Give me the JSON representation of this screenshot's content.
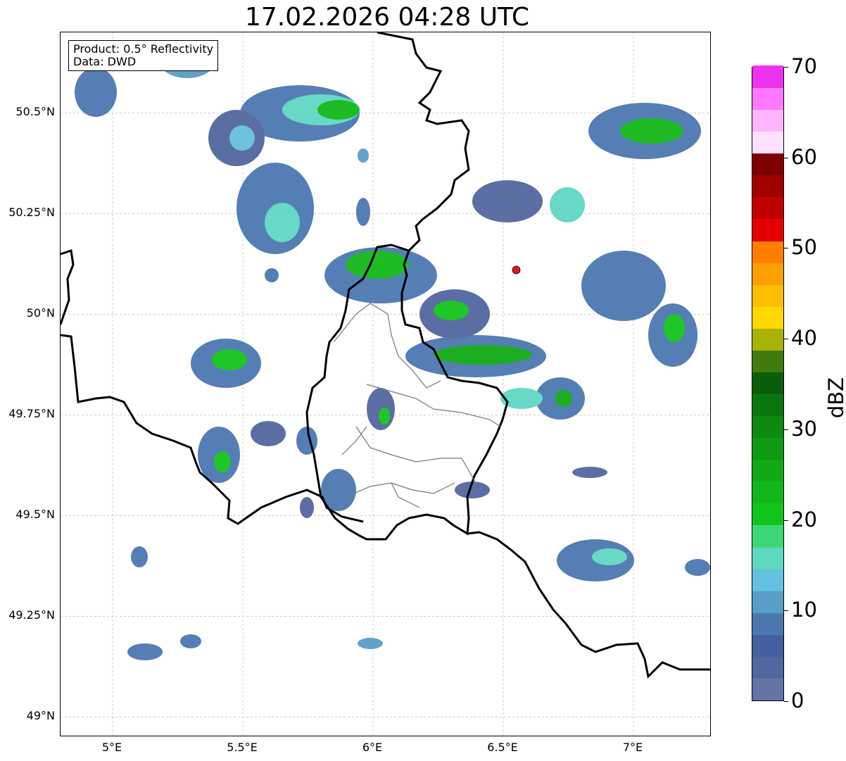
{
  "title": "17.02.2026 04:28 UTC",
  "info": {
    "product": "Product: 0.5° Reflectivity",
    "data": "Data: DWD"
  },
  "map": {
    "lon_range": [
      4.8,
      7.3
    ],
    "lat_range": [
      48.95,
      50.7
    ],
    "lat_ticks": [
      {
        "value": 50.5,
        "label": "50.5°N"
      },
      {
        "value": 50.25,
        "label": "50.25°N"
      },
      {
        "value": 50.0,
        "label": "50°N"
      },
      {
        "value": 49.75,
        "label": "49.75°N"
      },
      {
        "value": 49.5,
        "label": "49.5°N"
      },
      {
        "value": 49.25,
        "label": "49.25°N"
      },
      {
        "value": 49.0,
        "label": "49°N"
      }
    ],
    "lon_ticks": [
      {
        "value": 5.0,
        "label": "5°E"
      },
      {
        "value": 5.5,
        "label": "5.5°E"
      },
      {
        "value": 6.0,
        "label": "6°E"
      },
      {
        "value": 6.5,
        "label": "6.5°E"
      },
      {
        "value": 7.0,
        "label": "7°E"
      }
    ],
    "radar_site": {
      "lon": 6.55,
      "lat": 50.11,
      "color": "#e8161c"
    },
    "grid": true
  },
  "colorbar": {
    "label": "dBZ",
    "range": [
      0,
      70
    ],
    "ticks": [
      {
        "value": 0,
        "label": "0"
      },
      {
        "value": 10,
        "label": "10"
      },
      {
        "value": 20,
        "label": "20"
      },
      {
        "value": 30,
        "label": "30"
      },
      {
        "value": 40,
        "label": "40"
      },
      {
        "value": 50,
        "label": "50"
      },
      {
        "value": 60,
        "label": "60"
      },
      {
        "value": 70,
        "label": "70"
      }
    ],
    "colors": [
      "#6574a6",
      "#53679f",
      "#4560a2",
      "#4c78b0",
      "#5a9dc6",
      "#64c0dc",
      "#5fd8c4",
      "#3dd77a",
      "#12c51c",
      "#12b81a",
      "#12a916",
      "#0f9a13",
      "#0d8a10",
      "#0b760d",
      "#0a5e0b",
      "#437a10",
      "#aab208",
      "#ffd800",
      "#ffbd00",
      "#ff9e00",
      "#ff7e00",
      "#e40000",
      "#c00000",
      "#a00000",
      "#7e0000",
      "#ffe0ff",
      "#ffb4ff",
      "#ff78ff",
      "#ee33ee"
    ]
  }
}
